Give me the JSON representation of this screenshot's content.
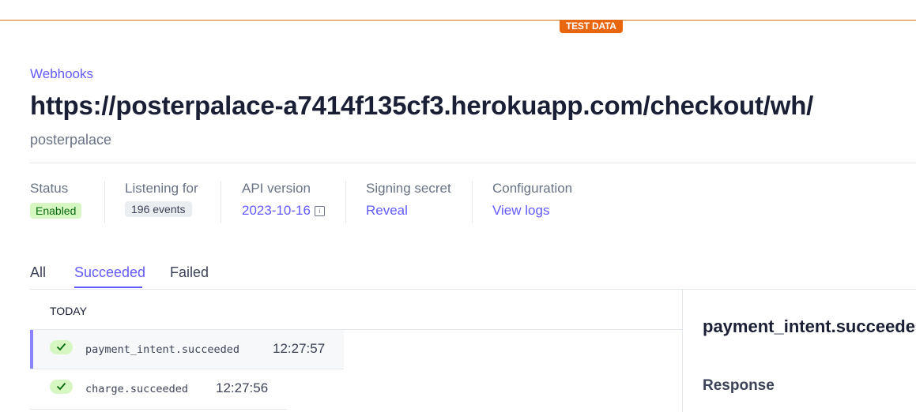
{
  "banner": {
    "label": "TEST DATA"
  },
  "breadcrumb": "Webhooks",
  "endpoint": {
    "url": "https://posterpalace-a7414f135cf3.herokuapp.com/checkout/wh/",
    "description": "posterpalace"
  },
  "meta": {
    "status": {
      "label": "Status",
      "value": "Enabled"
    },
    "listening": {
      "label": "Listening for",
      "value": "196 events"
    },
    "api_version": {
      "label": "API version",
      "value": "2023-10-16",
      "icon": "info-icon"
    },
    "signing_secret": {
      "label": "Signing secret",
      "value": "Reveal"
    },
    "configuration": {
      "label": "Configuration",
      "value": "View logs"
    }
  },
  "tabs": [
    {
      "label": "All",
      "active": false
    },
    {
      "label": "Succeeded",
      "active": true
    },
    {
      "label": "Failed",
      "active": false
    }
  ],
  "events": {
    "group_label": "TODAY",
    "items": [
      {
        "name": "payment_intent.succeeded",
        "time": "12:27:57",
        "status_icon": "check-icon",
        "selected": true
      },
      {
        "name": "charge.succeeded",
        "time": "12:27:56",
        "status_icon": "check-icon",
        "selected": false
      }
    ]
  },
  "detail": {
    "title": "payment_intent.succeeded",
    "section_label": "Response"
  },
  "colors": {
    "accent": "#635bff",
    "test_badge": "#e8660e",
    "success_bg": "#d7f7c2",
    "success_fg": "#05690d"
  }
}
